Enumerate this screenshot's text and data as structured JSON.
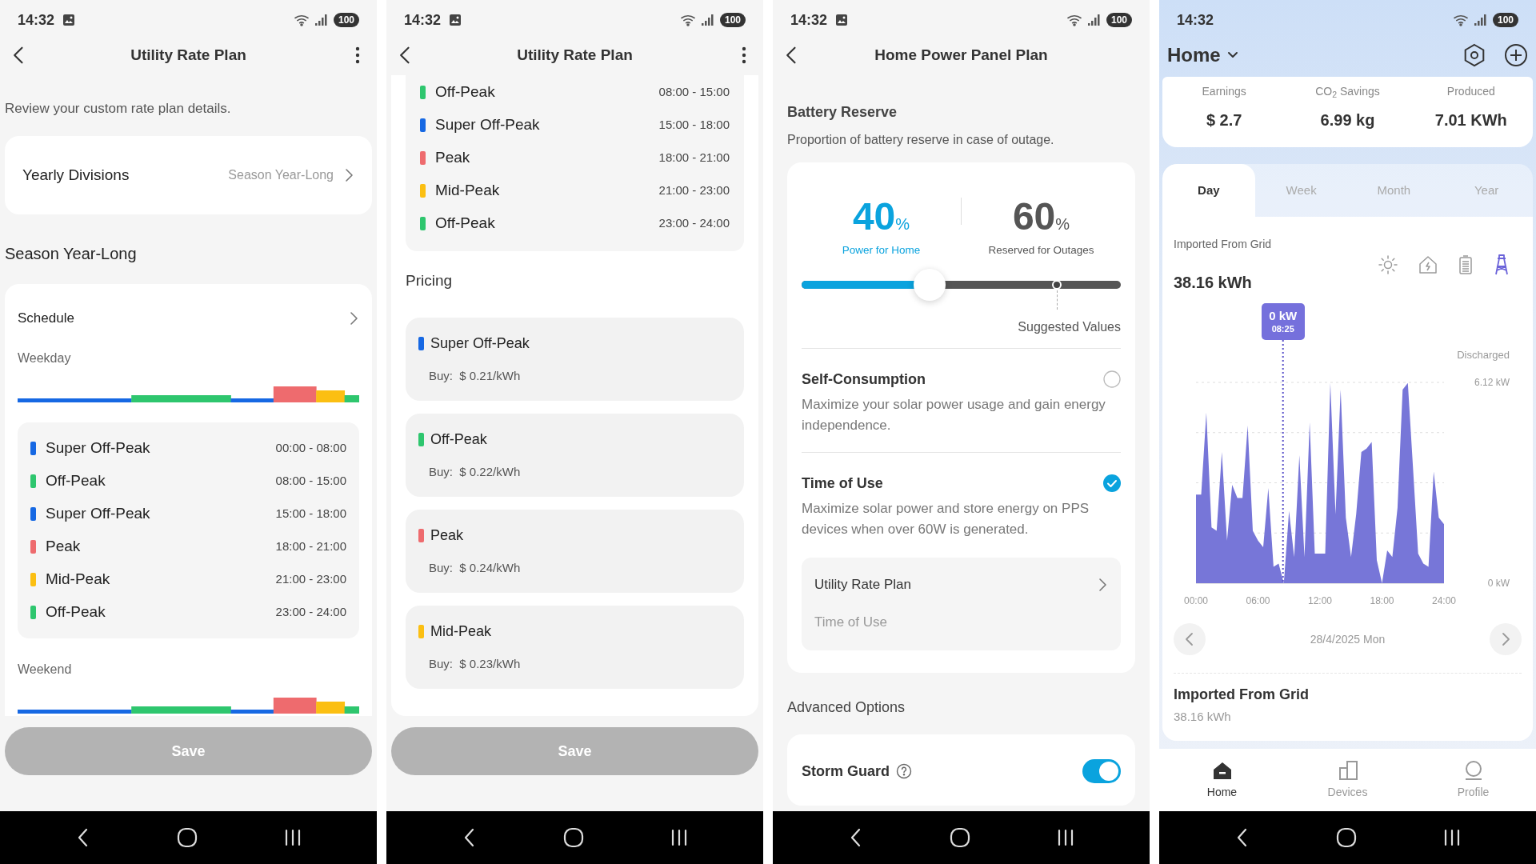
{
  "screens": [
    {
      "kind": "rate_plan_overview",
      "status_bar": {
        "time": "14:32",
        "image_notification": true,
        "battery": "100"
      },
      "header": {
        "title": "Utility Rate Plan",
        "menu": true
      },
      "intro": "Review your custom rate plan details.",
      "yearly_divisions": {
        "label": "Yearly Divisions",
        "value": "Season Year-Long"
      },
      "season_title": "Season Year-Long",
      "schedule": {
        "title": "Schedule",
        "weekday": {
          "label": "Weekday"
        },
        "periods": [
          {
            "name": "Super Off-Peak",
            "time": "00:00 - 08:00",
            "color": "#1668e3"
          },
          {
            "name": "Off-Peak",
            "time": "08:00 - 15:00",
            "color": "#2ec66e"
          },
          {
            "name": "Super Off-Peak",
            "time": "15:00 - 18:00",
            "color": "#1668e3"
          },
          {
            "name": "Peak",
            "time": "18:00 - 21:00",
            "color": "#ee6b6e"
          },
          {
            "name": "Mid-Peak",
            "time": "21:00 - 23:00",
            "color": "#fbbf12"
          },
          {
            "name": "Off-Peak",
            "time": "23:00 - 24:00",
            "color": "#2ec66e"
          }
        ],
        "weekend": {
          "label": "Weekend"
        }
      },
      "save_button": {
        "label": "Save",
        "disabled": true
      }
    },
    {
      "kind": "rate_plan_pricing",
      "status_bar": {
        "time": "14:32",
        "image_notification": true,
        "battery": "100"
      },
      "header": {
        "title": "Utility Rate Plan",
        "menu": true
      },
      "periods": [
        {
          "name": "Off-Peak",
          "time": "08:00 - 15:00",
          "color": "#2ec66e"
        },
        {
          "name": "Super Off-Peak",
          "time": "15:00 - 18:00",
          "color": "#1668e3"
        },
        {
          "name": "Peak",
          "time": "18:00 - 21:00",
          "color": "#ee6b6e"
        },
        {
          "name": "Mid-Peak",
          "time": "21:00 - 23:00",
          "color": "#fbbf12"
        },
        {
          "name": "Off-Peak",
          "time": "23:00 - 24:00",
          "color": "#2ec66e"
        }
      ],
      "pricing_title": "Pricing",
      "prices": [
        {
          "name": "Super Off-Peak",
          "price": "Buy:  $ 0.21/kWh",
          "color": "#1668e3"
        },
        {
          "name": "Off-Peak",
          "price": "Buy:  $ 0.22/kWh",
          "color": "#2ec66e"
        },
        {
          "name": "Peak",
          "price": "Buy:  $ 0.24/kWh",
          "color": "#ee6b6e"
        },
        {
          "name": "Mid-Peak",
          "price": "Buy:  $ 0.23/kWh",
          "color": "#fbbf12"
        }
      ],
      "save_button": {
        "label": "Save",
        "disabled": true
      }
    },
    {
      "kind": "power_panel_plan",
      "status_bar": {
        "time": "14:32",
        "image_notification": true,
        "battery": "100"
      },
      "header": {
        "title": "Home Power Panel Plan",
        "menu": false
      },
      "battery_reserve": {
        "title": "Battery Reserve",
        "description": "Proportion of battery reserve in case of outage.",
        "home": {
          "value": "40",
          "unit": "%",
          "label": "Power for Home"
        },
        "reserve": {
          "value": "60",
          "unit": "%",
          "label": "Reserved for Outages"
        },
        "slider": {
          "level": 0.4
        },
        "suggested": {
          "level": 0.8,
          "label": "Suggested Values"
        }
      },
      "modes": [
        {
          "title": "Self-Consumption",
          "description": "Maximize your solar power usage and gain energy independence.",
          "selected": false
        },
        {
          "title": "Time of Use",
          "description": "Maximize solar power and store energy on PPS devices when over 60W is generated.",
          "selected": true,
          "plan": {
            "title": "Utility Rate Plan",
            "value": "Time of Use"
          }
        }
      ],
      "advanced": {
        "title": "Advanced Options",
        "items": [
          {
            "label": "Storm Guard",
            "on": true
          }
        ]
      }
    },
    {
      "kind": "home_dashboard",
      "status_bar": {
        "time": "14:32",
        "image_notification": false,
        "battery": "100"
      },
      "header": {
        "title": "Home"
      },
      "stats": [
        {
          "label": "Earnings",
          "value": "$ 2.7"
        },
        {
          "label": "CO$_{2}$ Savings",
          "value": "6.99 kg"
        },
        {
          "label": "Produced",
          "value": "7.01 KWh"
        }
      ],
      "period_tabs": [
        {
          "label": "Day",
          "selected": true
        },
        {
          "label": "Week",
          "selected": false
        },
        {
          "label": "Month",
          "selected": false
        },
        {
          "label": "Year",
          "selected": false
        }
      ],
      "energy": {
        "title": "Imported From Grid",
        "value": "38.16 kWh",
        "sources": [
          {
            "kind": "solar",
            "selected": false
          },
          {
            "kind": "home",
            "selected": false
          },
          {
            "kind": "battery",
            "selected": false
          },
          {
            "kind": "grid",
            "selected": true
          }
        ],
        "chart_data": {
          "type": "area",
          "ylabel": "Discharged",
          "xlim": [
            0,
            24
          ],
          "ylim": [
            0,
            6.12
          ],
          "annotations": [
            "0 kW"
          ],
          "ref_lines": [
            {
              "axis": "x",
              "value": 8.4167,
              "color": "#5a52c9"
            }
          ],
          "xticks": [
            {
              "value": 0,
              "label": "00:00"
            },
            {
              "value": 6,
              "label": "06:00"
            },
            {
              "value": 12,
              "label": "12:00"
            },
            {
              "value": 18,
              "label": "18:00"
            },
            {
              "value": 24,
              "label": "24:00"
            }
          ],
          "yticks": [
            {
              "value": 0,
              "label": "0 kW"
            },
            {
              "value": 6.12,
              "label": "6.12 kW"
            }
          ],
          "x": [
            0,
            0.5,
            1,
            1.5,
            2,
            2.5,
            3,
            3.5,
            4,
            4.5,
            5,
            5.5,
            6,
            6.5,
            7,
            7.5,
            8,
            8.5,
            9,
            9.5,
            10,
            10.5,
            11,
            11.5,
            12,
            12.5,
            13,
            13.5,
            14,
            14.5,
            15,
            15.5,
            16,
            16.5,
            17,
            17.5,
            18,
            18.5,
            19,
            19.5,
            20,
            20.5,
            21,
            21.5,
            22,
            22.5,
            23,
            23.5,
            24
          ],
          "series": [
            {
              "color": "#7776d8",
              "values": [
                2.7,
                2.7,
                5.2,
                1.7,
                1.6,
                4.0,
                1.3,
                3.0,
                2.6,
                2.6,
                4.8,
                1.6,
                1.3,
                1.1,
                2.9,
                0.5,
                0.6,
                0.0,
                2.2,
                0.8,
                3.9,
                0.8,
                4.9,
                0.9,
                0.9,
                0.9,
                6.1,
                2.1,
                5.9,
                2.0,
                0.8,
                2.1,
                4.0,
                4.1,
                4.3,
                0.7,
                0.0,
                1.0,
                0.8,
                2.3,
                5.9,
                6.1,
                3.5,
                0.9,
                0.6,
                0.5,
                3.4,
                2.0,
                1.8
              ]
            }
          ]
        },
        "tooltip_time": "08:25",
        "date": "28/4/2025 Mon"
      },
      "summary": {
        "title": "Imported From Grid",
        "value": "38.16 kWh"
      },
      "bottom_tabs": [
        {
          "kind": "home",
          "label": "Home",
          "selected": true
        },
        {
          "kind": "devices",
          "label": "Devices",
          "selected": false
        },
        {
          "kind": "profile",
          "label": "Profile",
          "selected": false
        }
      ]
    }
  ]
}
